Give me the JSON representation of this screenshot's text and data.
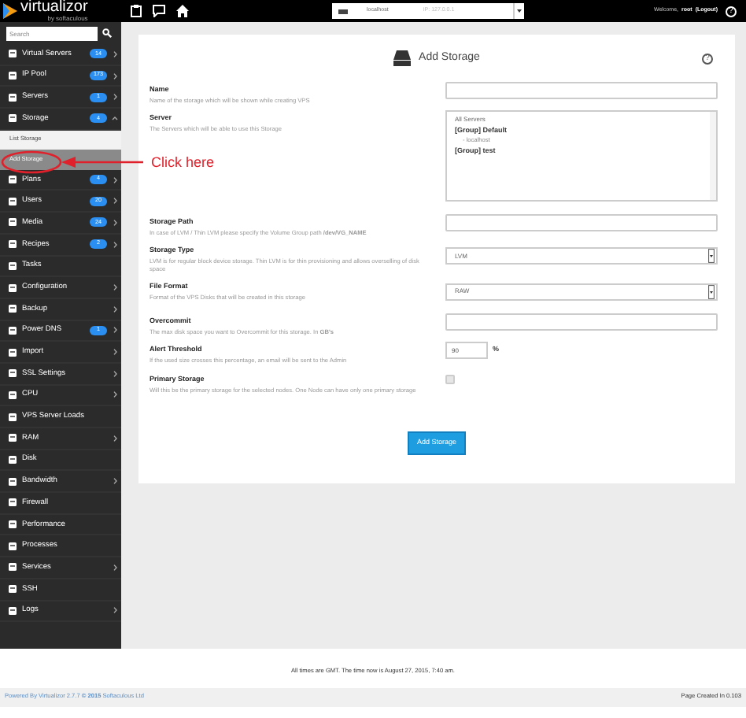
{
  "top_bar": {
    "logo": "virtualizor",
    "logo_tagline": "by softaculous",
    "server_select": {
      "value": "localhost",
      "ip": "IP: 127.0.0.1"
    },
    "welcome": "Welcome,",
    "user": "root",
    "logout": "(Logout)",
    "help": "?"
  },
  "sidebar": {
    "search": {
      "placeholder": "Search"
    },
    "items": [
      {
        "label": "Virtual Servers",
        "badge": "14",
        "has_submenu": true,
        "expanded": false
      },
      {
        "label": "IP Pool",
        "badge": "173",
        "has_submenu": true,
        "expanded": false
      },
      {
        "label": "Servers",
        "badge": "1",
        "has_submenu": true,
        "expanded": false
      },
      {
        "label": "Storage",
        "badge": "4",
        "has_submenu": true,
        "expanded": true,
        "children": [
          {
            "label": "List Storage",
            "selected": false
          },
          {
            "label": "Add Storage",
            "selected": true
          }
        ]
      },
      {
        "label": "Plans",
        "badge": "4",
        "has_submenu": true,
        "expanded": false
      },
      {
        "label": "Users",
        "badge": "20",
        "has_submenu": true,
        "expanded": false
      },
      {
        "label": "Media",
        "badge": "24",
        "has_submenu": true,
        "expanded": false
      },
      {
        "label": "Recipes",
        "badge": "2",
        "has_submenu": true,
        "expanded": false
      },
      {
        "label": "Tasks",
        "has_submenu": false,
        "expanded": false
      },
      {
        "label": "Configuration",
        "has_submenu": true,
        "expanded": false
      },
      {
        "label": "Backup",
        "has_submenu": true,
        "expanded": false
      },
      {
        "label": "Power DNS",
        "badge": "1",
        "has_submenu": true,
        "expanded": false
      },
      {
        "label": "Import",
        "has_submenu": true,
        "expanded": false
      },
      {
        "label": "SSL Settings",
        "has_submenu": true,
        "expanded": false
      },
      {
        "label": "CPU",
        "has_submenu": true,
        "expanded": false
      },
      {
        "label": "VPS Server Loads",
        "has_submenu": false,
        "expanded": false
      },
      {
        "label": "RAM",
        "has_submenu": true,
        "expanded": false
      },
      {
        "label": "Disk",
        "has_submenu": false,
        "expanded": false
      },
      {
        "label": "Bandwidth",
        "has_submenu": true,
        "expanded": false
      },
      {
        "label": "Firewall",
        "has_submenu": false,
        "expanded": false
      },
      {
        "label": "Performance",
        "has_submenu": false,
        "expanded": false
      },
      {
        "label": "Processes",
        "has_submenu": false,
        "expanded": false
      },
      {
        "label": "Services",
        "has_submenu": true,
        "expanded": false
      },
      {
        "label": "SSH",
        "has_submenu": false,
        "expanded": false
      },
      {
        "label": "Logs",
        "has_submenu": true,
        "expanded": false
      }
    ]
  },
  "annotation": {
    "text": "Click here"
  },
  "panel": {
    "title": "Add Storage",
    "help": "?",
    "fields": [
      {
        "kind": "text",
        "label": "Name",
        "description": "Name of the storage which will be shown while creating VPS"
      },
      {
        "kind": "listbox",
        "label": "Server",
        "description": "The Servers which will be able to use this Storage",
        "options": [
          {
            "kind": "all",
            "text": "All Servers"
          },
          {
            "kind": "group",
            "text": "[Group] Default"
          },
          {
            "kind": "server",
            "text": "- localhost"
          },
          {
            "kind": "group",
            "text": "[Group] test"
          }
        ]
      },
      {
        "kind": "text",
        "label": "Storage Path",
        "description": "In case of LVM / Thin LVM please specify the Volume Group path **/dev/VG_NAME**"
      },
      {
        "kind": "select",
        "label": "Storage Type",
        "description": "LVM is for regular block device storage. Thin LVM is for thin provisioning and allows overselling of disk space",
        "value": "LVM"
      },
      {
        "kind": "select",
        "label": "File Format",
        "description": "Format of the VPS Disks that will be created in this storage",
        "value": "RAW"
      },
      {
        "kind": "text",
        "label": "Overcommit",
        "description": "The max disk space you want to Overcommit for this storage. In **GB's**"
      },
      {
        "kind": "number",
        "label": "Alert Threshold",
        "description": "If the used size crosses this percentage, an email will be sent to the Admin",
        "value": "90",
        "suffix": "%"
      },
      {
        "kind": "checkbox",
        "label": "Primary Storage",
        "description": "Will this be the primary storage for the selected nodes. One Node can have only one primary storage",
        "checked": false
      }
    ],
    "submit": "Add Storage"
  },
  "footer": {
    "time_note": "All times are GMT. The time now is August 27, 2015, 7:40 am.",
    "powered_by": "Powered By Virtualizor 2.7.7 **© 2015** Softaculous Ltd",
    "page_created": "Page Created In 0.103"
  }
}
